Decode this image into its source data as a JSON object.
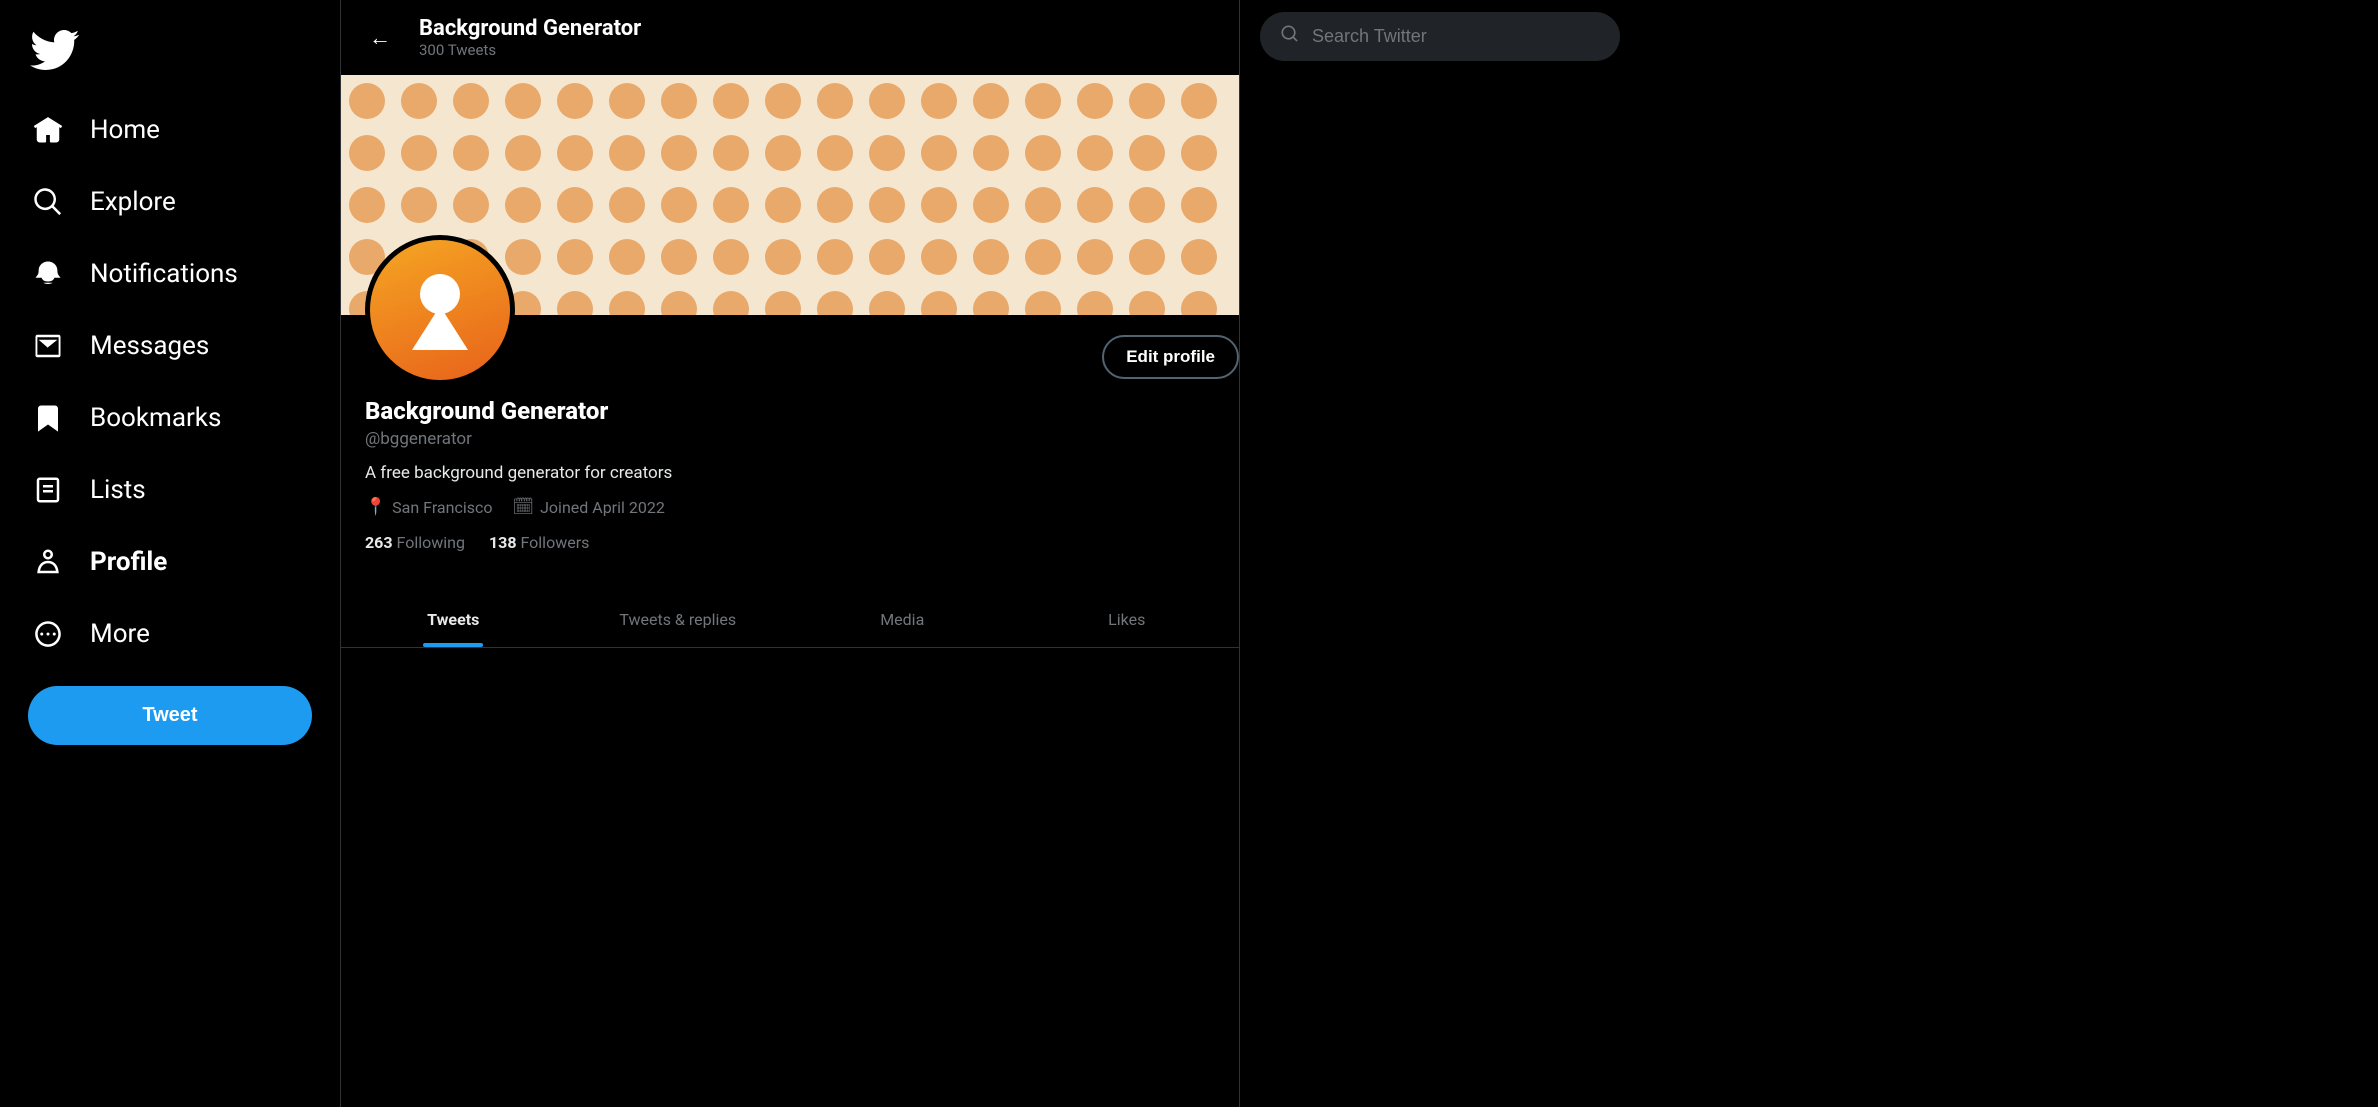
{
  "sidebar": {
    "twitter_logo_label": "Twitter",
    "items": [
      {
        "id": "home",
        "label": "Home",
        "icon": "🏠"
      },
      {
        "id": "explore",
        "label": "Explore",
        "icon": "#"
      },
      {
        "id": "notifications",
        "label": "Notifications",
        "icon": "🔔"
      },
      {
        "id": "messages",
        "label": "Messages",
        "icon": "✉"
      },
      {
        "id": "bookmarks",
        "label": "Bookmarks",
        "icon": "🔖"
      },
      {
        "id": "lists",
        "label": "Lists",
        "icon": "📋"
      },
      {
        "id": "profile",
        "label": "Profile",
        "icon": "👤",
        "active": true
      },
      {
        "id": "more",
        "label": "More",
        "icon": "⋯"
      }
    ],
    "tweet_button_label": "Tweet"
  },
  "header": {
    "back_label": "←",
    "profile_name": "Background Generator",
    "tweet_count": "300 Tweets"
  },
  "profile": {
    "name": "Background Generator",
    "handle": "@bggenerator",
    "bio": "A free background generator for creators",
    "location": "San Francisco",
    "joined": "Joined April 2022",
    "following_count": "263",
    "following_label": "Following",
    "followers_count": "138",
    "followers_label": "Followers",
    "edit_button_label": "Edit profile"
  },
  "tabs": [
    {
      "id": "tweets",
      "label": "Tweets",
      "active": true
    },
    {
      "id": "tweets-replies",
      "label": "Tweets & replies",
      "active": false
    },
    {
      "id": "media",
      "label": "Media",
      "active": false
    },
    {
      "id": "likes",
      "label": "Likes",
      "active": false
    }
  ],
  "search": {
    "placeholder": "Search Twitter"
  },
  "colors": {
    "accent": "#1d9bf0",
    "bg": "#000000",
    "banner_bg": "#f5e6d0",
    "dot_color": "#e8a96b",
    "avatar_gradient_start": "#f5a623",
    "avatar_gradient_end": "#e8621a"
  }
}
